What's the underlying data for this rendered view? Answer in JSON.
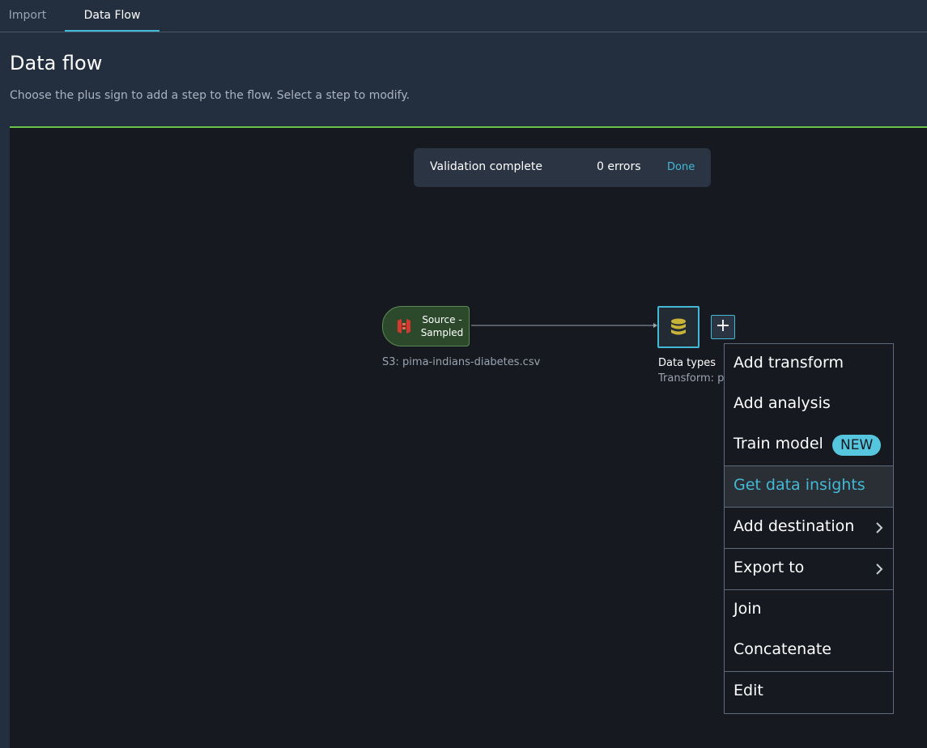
{
  "tabs": [
    {
      "label": "Import"
    },
    {
      "label": "Data Flow"
    }
  ],
  "page": {
    "title": "Data flow",
    "description": "Choose the plus sign to add a step to the flow. Select a step to modify."
  },
  "toast": {
    "label": "Validation complete",
    "errors": "0 errors",
    "done": "Done"
  },
  "nodes": {
    "source": {
      "label": "Source - Sampled",
      "caption": "S3: pima-indians-diabetes.csv",
      "icon": "s3-bucket-icon"
    },
    "datatypes": {
      "label": "Data types",
      "caption": "Transform: pima-indians-diabetes.csv",
      "icon": "database-icon"
    },
    "plus": "+"
  },
  "menu": {
    "items": [
      {
        "label": "Add transform"
      },
      {
        "label": "Add analysis"
      },
      {
        "label": "Train model",
        "badge": "NEW"
      },
      {
        "label": "Get data insights"
      },
      {
        "label": "Add destination"
      },
      {
        "label": "Export to"
      },
      {
        "label": "Join"
      },
      {
        "label": "Concatenate"
      },
      {
        "label": "Edit"
      }
    ]
  },
  "colors": {
    "accent": "#44b9d6",
    "canvas_border": "#6ac34a",
    "source_node_bg": "#2c4a2b",
    "badge_bg": "#56c5de",
    "s3_icon": "#d13b2f",
    "db_icon": "#c9b338"
  }
}
